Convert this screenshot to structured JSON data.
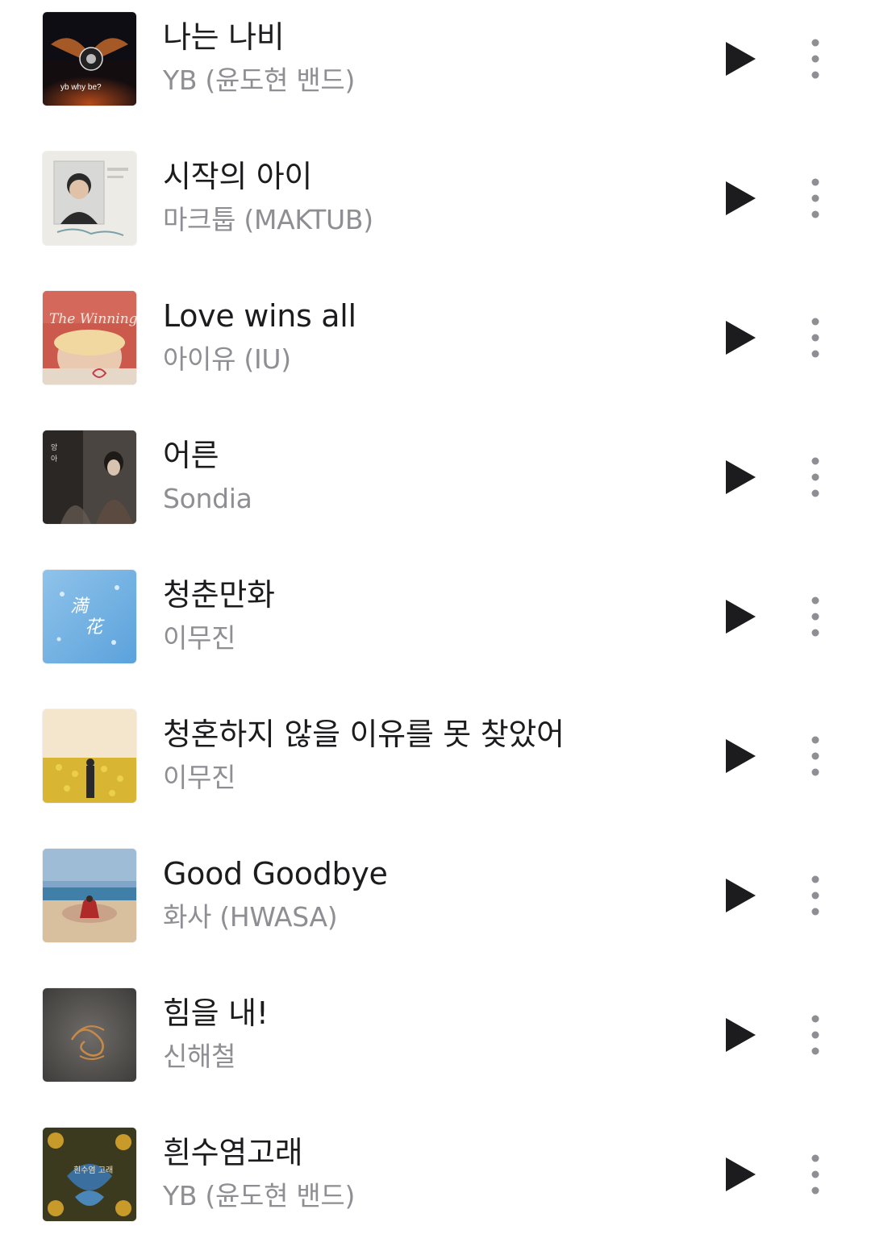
{
  "tracks": [
    {
      "title": "나는 나비",
      "artist": "YB (윤도현 밴드)",
      "cover_icon": "album-cover-nabi",
      "cover_text": "yb why be?"
    },
    {
      "title": "시작의 아이",
      "artist": "마크툽 (MAKTUB)",
      "cover_icon": "album-cover-sijak"
    },
    {
      "title": "Love wins all",
      "artist": "아이유 (IU)",
      "cover_icon": "album-cover-winning",
      "cover_text": "The Winning"
    },
    {
      "title": "어른",
      "artist": "Sondia",
      "cover_icon": "album-cover-eoreun"
    },
    {
      "title": "청춘만화",
      "artist": "이무진",
      "cover_icon": "album-cover-cheongchun"
    },
    {
      "title": "청혼하지 않을 이유를 못 찾았어",
      "artist": "이무진",
      "cover_icon": "album-cover-cheonghon"
    },
    {
      "title": "Good Goodbye",
      "artist": "화사 (HWASA)",
      "cover_icon": "album-cover-goodbye"
    },
    {
      "title": "힘을 내!",
      "artist": "신해철",
      "cover_icon": "album-cover-himeul"
    },
    {
      "title": "흰수염고래",
      "artist": "YB (윤도현 밴드)",
      "cover_icon": "album-cover-whale",
      "cover_text": "흰수염 고래"
    }
  ],
  "controls": {
    "play_icon": "play-icon",
    "more_icon": "more-vertical-icon"
  },
  "colors": {
    "title": "#1c1c1e",
    "artist": "#8e8e93",
    "icon": "#1c1c1e",
    "more_dots": "#8e8e93"
  }
}
